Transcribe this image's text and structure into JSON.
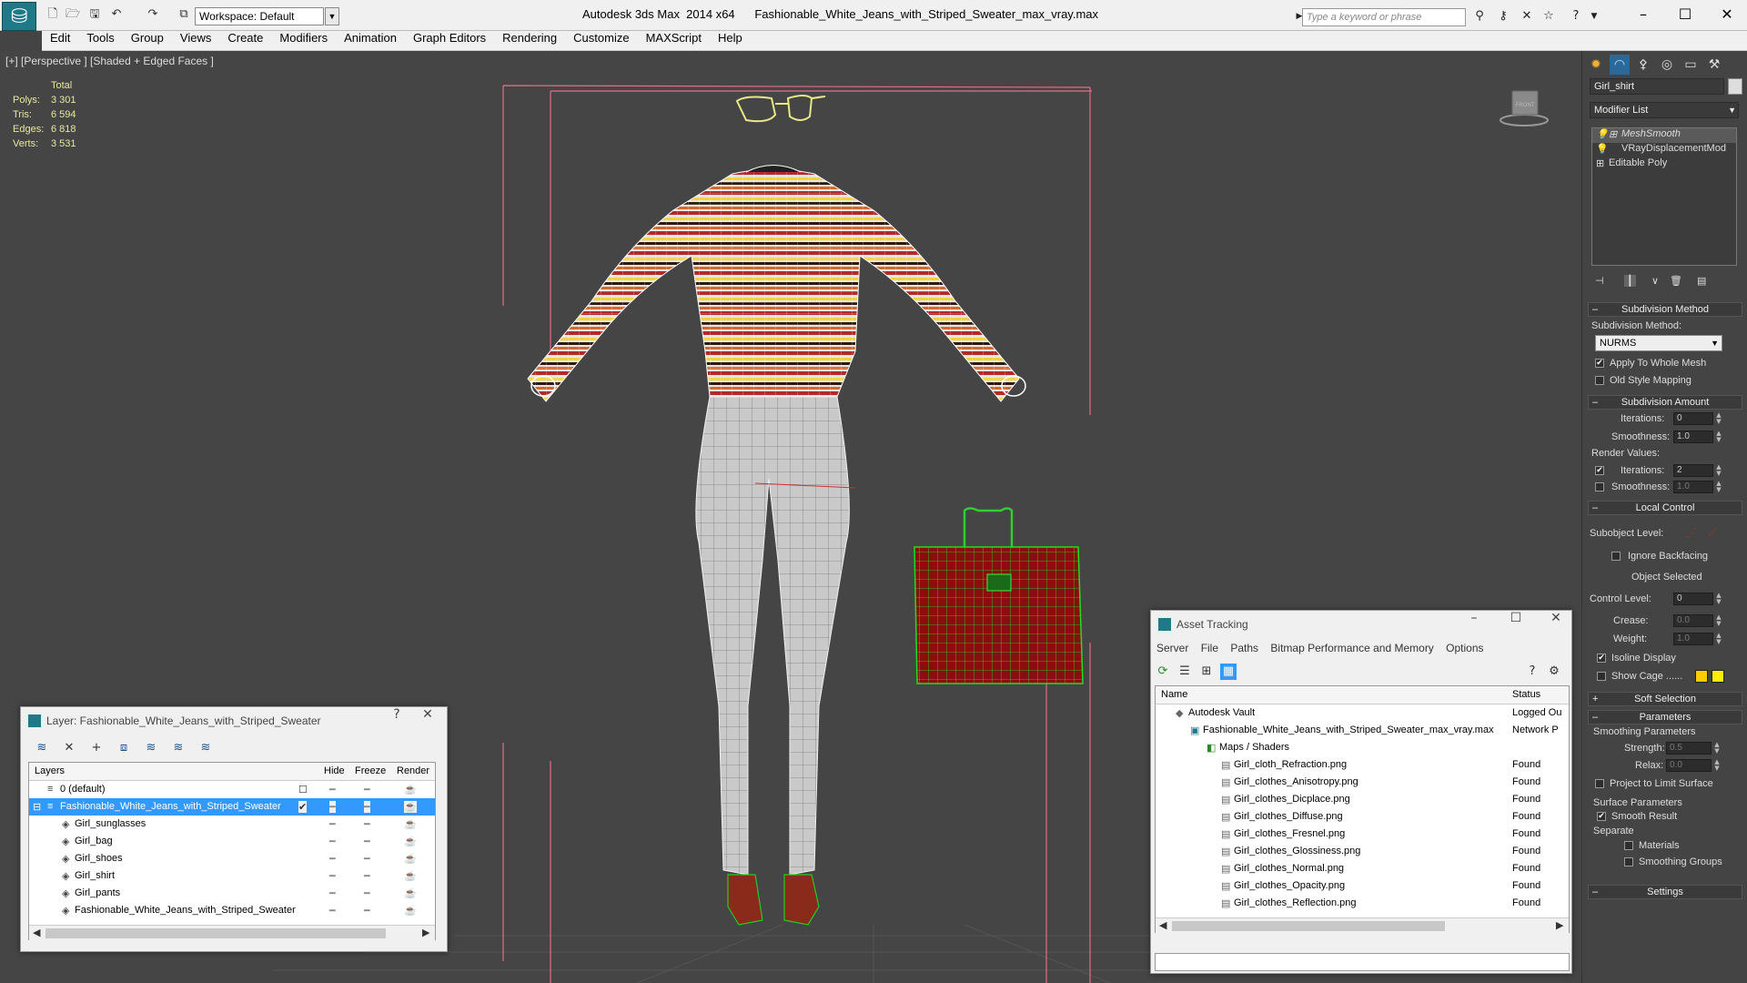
{
  "app": {
    "workspace": "Workspace: Default",
    "title": "Autodesk 3ds Max  2014 x64      Fashionable_White_Jeans_with_Striped_Sweater_max_vray.max",
    "search_placeholder": "Type a keyword or phrase"
  },
  "menu": [
    "Edit",
    "Tools",
    "Group",
    "Views",
    "Create",
    "Modifiers",
    "Animation",
    "Graph Editors",
    "Rendering",
    "Customize",
    "MAXScript",
    "Help"
  ],
  "viewport": {
    "label": "[+] [Perspective ] [Shaded + Edged Faces ]",
    "stats": {
      "header": "Total",
      "rows": [
        {
          "k": "Polys:",
          "v": "3 301"
        },
        {
          "k": "Tris:",
          "v": "6 594"
        },
        {
          "k": "Edges:",
          "v": "6 818"
        },
        {
          "k": "Verts:",
          "v": "3 531"
        }
      ]
    },
    "viewcube_label": "FRONT"
  },
  "layer_window": {
    "title": "Layer: Fashionable_White_Jeans_with_Striped_Sweater",
    "help": "?",
    "columns": {
      "name": "Layers",
      "hide": "Hide",
      "freeze": "Freeze",
      "render": "Render"
    },
    "rows": [
      {
        "label": "0 (default)",
        "level": 0,
        "selected": false
      },
      {
        "label": "Fashionable_White_Jeans_with_Striped_Sweater",
        "level": 0,
        "selected": true
      },
      {
        "label": "Girl_sunglasses",
        "level": 1,
        "selected": false
      },
      {
        "label": "Girl_bag",
        "level": 1,
        "selected": false
      },
      {
        "label": "Girl_shoes",
        "level": 1,
        "selected": false
      },
      {
        "label": "Girl_shirt",
        "level": 1,
        "selected": false
      },
      {
        "label": "Girl_pants",
        "level": 1,
        "selected": false
      },
      {
        "label": "Fashionable_White_Jeans_with_Striped_Sweater",
        "level": 1,
        "selected": false
      }
    ]
  },
  "asset_window": {
    "title": "Asset Tracking",
    "menu": [
      "Server",
      "File",
      "Paths",
      "Bitmap Performance and Memory",
      "Options"
    ],
    "columns": {
      "name": "Name",
      "status": "Status"
    },
    "rows": [
      {
        "name": "Autodesk Vault",
        "status": "Logged Ou",
        "level": 1
      },
      {
        "name": "Fashionable_White_Jeans_with_Striped_Sweater_max_vray.max",
        "status": "Network P",
        "level": 2
      },
      {
        "name": "Maps / Shaders",
        "status": "",
        "level": 3
      },
      {
        "name": "Girl_cloth_Refraction.png",
        "status": "Found",
        "level": 4
      },
      {
        "name": "Girl_clothes_Anisotropy.png",
        "status": "Found",
        "level": 4
      },
      {
        "name": "Girl_clothes_Dicplace.png",
        "status": "Found",
        "level": 4
      },
      {
        "name": "Girl_clothes_Diffuse.png",
        "status": "Found",
        "level": 4
      },
      {
        "name": "Girl_clothes_Fresnel.png",
        "status": "Found",
        "level": 4
      },
      {
        "name": "Girl_clothes_Glossiness.png",
        "status": "Found",
        "level": 4
      },
      {
        "name": "Girl_clothes_Normal.png",
        "status": "Found",
        "level": 4
      },
      {
        "name": "Girl_clothes_Opacity.png",
        "status": "Found",
        "level": 4
      },
      {
        "name": "Girl_clothes_Reflection.png",
        "status": "Found",
        "level": 4
      }
    ]
  },
  "command_panel": {
    "object_name": "Girl_shirt",
    "modifier_list": "Modifier List",
    "stack": [
      "MeshSmooth",
      "VRayDisplacementMod",
      "Editable Poly"
    ],
    "subdivision_method": {
      "title": "Subdivision Method",
      "label": "Subdivision Method:",
      "value": "NURMS",
      "apply_whole": "Apply To Whole Mesh",
      "old_style": "Old Style Mapping"
    },
    "subdivision_amount": {
      "title": "Subdivision Amount",
      "iterations_label": "Iterations:",
      "iterations": "0",
      "smoothness_label": "Smoothness:",
      "smoothness": "1.0",
      "render_values": "Render Values:",
      "r_iterations": "2",
      "r_smoothness": "1.0"
    },
    "local_control": {
      "title": "Local Control",
      "subobject": "Subobject Level:",
      "ignore_backfacing": "Ignore Backfacing",
      "object_selected": "Object Selected",
      "control_level_label": "Control Level:",
      "control_level": "0",
      "crease_label": "Crease:",
      "crease": "0.0",
      "weight_label": "Weight:",
      "weight": "1.0",
      "isoline": "Isoline Display",
      "show_cage": "Show Cage ......"
    },
    "soft_selection": "Soft Selection",
    "parameters": {
      "title": "Parameters",
      "smoothing": "Smoothing Parameters",
      "strength_label": "Strength:",
      "strength": "0.5",
      "relax_label": "Relax:",
      "relax": "0.0",
      "project": "Project to Limit Surface",
      "surface": "Surface Parameters",
      "smooth_result": "Smooth Result",
      "separate": "Separate",
      "materials": "Materials",
      "smoothing_groups": "Smoothing Groups"
    },
    "settings": "Settings"
  },
  "colors": {
    "accent": "#1e7a86",
    "selection": "#3399ff",
    "cage1": "#ffcc00",
    "cage2": "#ffee00"
  }
}
